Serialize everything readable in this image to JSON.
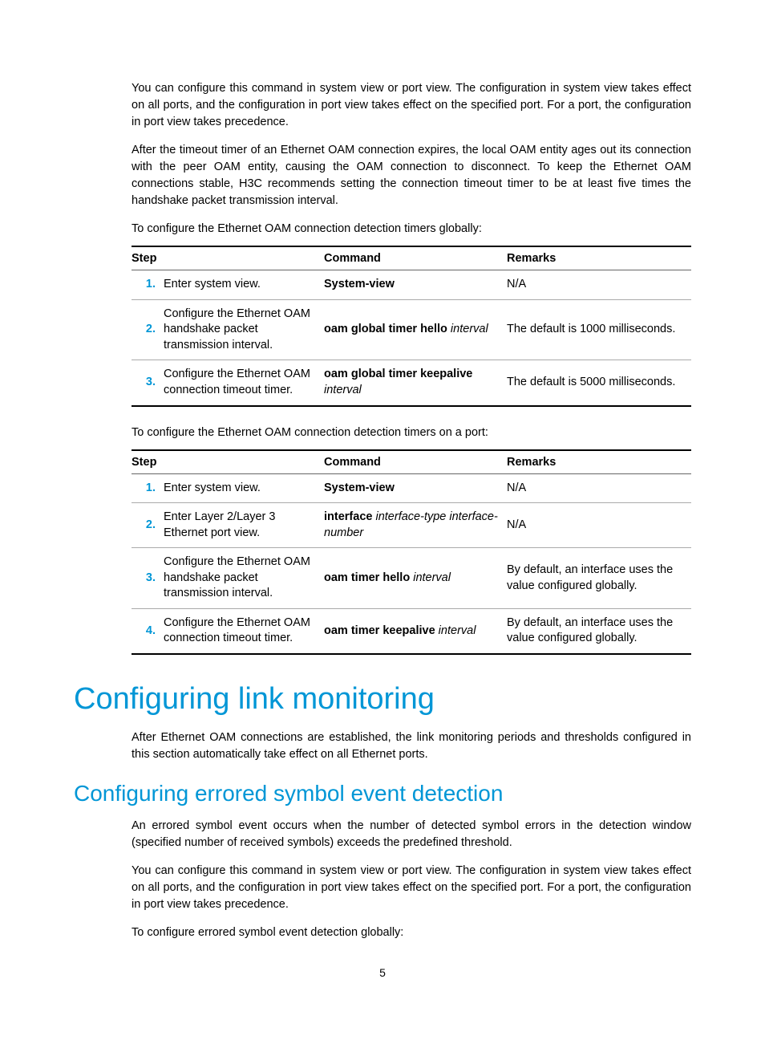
{
  "paragraphs": {
    "p1": "You can configure this command in system view or port view. The configuration in system view takes effect on all ports, and the configuration in port view takes effect on the specified port. For a port, the configuration in port view takes precedence.",
    "p2": "After the timeout timer of an Ethernet OAM connection expires, the local OAM entity ages out its connection with the peer OAM entity, causing the OAM connection to disconnect. To keep the Ethernet OAM connections stable, H3C recommends setting the connection timeout timer to be at least five times the handshake packet transmission interval.",
    "lead1": "To configure the Ethernet OAM connection detection timers globally:",
    "lead2": "To configure the Ethernet OAM connection detection timers on a port:",
    "p3": "After Ethernet OAM connections are established, the link monitoring periods and thresholds configured in this section automatically take effect on all Ethernet ports.",
    "p4": "An errored symbol event occurs when the number of detected symbol errors in the detection window (specified number of received symbols) exceeds the predefined threshold.",
    "p5": "You can configure this command in system view or port view. The configuration in system view takes effect on all ports, and the configuration in port view takes effect on the specified port. For a port, the configuration in port view takes precedence.",
    "lead3": "To configure errored symbol event detection globally:"
  },
  "headings": {
    "h1": "Configuring link monitoring",
    "h2": "Configuring errored symbol event detection"
  },
  "table_headers": {
    "step": "Step",
    "command": "Command",
    "remarks": "Remarks"
  },
  "table1": {
    "rows": [
      {
        "num": "1.",
        "step": "Enter system view.",
        "cmd_bold": "System-view",
        "cmd_ital": "",
        "remarks": "N/A"
      },
      {
        "num": "2.",
        "step": "Configure the Ethernet OAM handshake packet transmission interval.",
        "cmd_bold": "oam global timer hello",
        "cmd_ital": " interval",
        "remarks": "The default is 1000 milliseconds."
      },
      {
        "num": "3.",
        "step": "Configure the Ethernet OAM connection timeout timer.",
        "cmd_bold": "oam global timer keepalive",
        "cmd_ital": " interval",
        "remarks": "The default is 5000 milliseconds."
      }
    ]
  },
  "table2": {
    "rows": [
      {
        "num": "1.",
        "step": "Enter system view.",
        "cmd_bold": "System-view",
        "cmd_ital": "",
        "remarks": "N/A"
      },
      {
        "num": "2.",
        "step": "Enter Layer 2/Layer 3 Ethernet port view.",
        "cmd_bold": "interface",
        "cmd_ital": " interface-type interface-number",
        "remarks": "N/A"
      },
      {
        "num": "3.",
        "step": "Configure the Ethernet OAM handshake packet transmission interval.",
        "cmd_bold": "oam timer hello",
        "cmd_ital": " interval",
        "remarks": "By default, an interface uses the value configured globally."
      },
      {
        "num": "4.",
        "step": "Configure the Ethernet OAM connection timeout timer.",
        "cmd_bold": "oam timer keepalive",
        "cmd_ital": " interval",
        "remarks": "By default, an interface uses the value configured globally."
      }
    ]
  },
  "page_number": "5"
}
